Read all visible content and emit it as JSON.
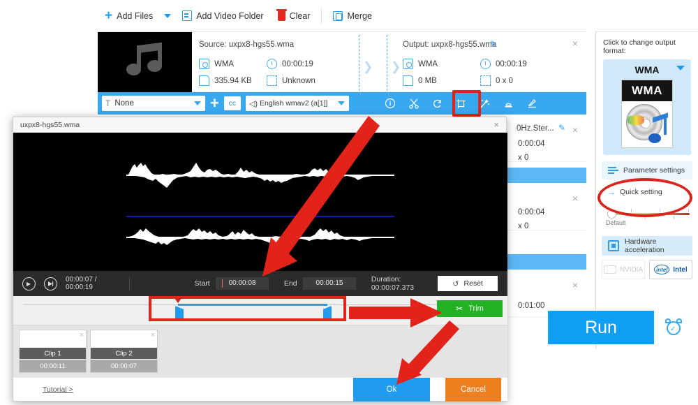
{
  "toolbar": {
    "add_files": "Add Files",
    "add_video_folder": "Add Video Folder",
    "clear": "Clear",
    "merge": "Merge"
  },
  "file_row": {
    "source_label": "Source: uxpx8-hgs55.wma",
    "output_label": "Output: uxpx8-hgs55.wma",
    "source_format": "WMA",
    "source_duration": "00:00:19",
    "source_size": "335.94 KB",
    "source_resolution": "Unknown",
    "output_format": "WMA",
    "output_duration": "00:00:19",
    "output_size": "0 MB",
    "output_resolution": "0 x 0",
    "close": "×",
    "edit_icon": "✎"
  },
  "blue_bar": {
    "subtitle_value": "None",
    "subtitle_icon": "T",
    "add": "+",
    "cc": "cc",
    "audio_track": "English wmav2 (a[1]]",
    "speaker_icon": "◁)",
    "tools": [
      {
        "name": "info-icon",
        "title": "Info"
      },
      {
        "name": "trim-icon",
        "title": "Trim"
      },
      {
        "name": "rotate-icon",
        "title": "Rotate"
      },
      {
        "name": "crop-icon",
        "title": "Crop"
      },
      {
        "name": "effect-icon",
        "title": "Effect"
      },
      {
        "name": "watermark-icon",
        "title": "Watermark"
      },
      {
        "name": "subtitle-icon",
        "title": "Subtitle"
      }
    ]
  },
  "background_rows": [
    {
      "title_fragment": "0Hz.Ster...",
      "duration": "0:00:04",
      "resolution": "x 0"
    },
    {
      "title_fragment": "",
      "duration": "0:00:04",
      "resolution": "x 0"
    },
    {
      "title_fragment": "",
      "duration": "0:01:00",
      "resolution": ""
    }
  ],
  "sidebar": {
    "hint": "Click to change output format:",
    "format_name": "WMA",
    "disc_label": "WMA",
    "parameter_settings": "Parameter settings",
    "quick_setting": "Quick setting",
    "slider_default_label": "Default",
    "hardware_acceleration": "Hardware acceleration",
    "gpu_nvidia": "NVIDIA",
    "gpu_intel": "Intel",
    "intel_badge": "intel",
    "run": "Run"
  },
  "dialog": {
    "title": "uxpx8-hgs55.wma",
    "close": "×",
    "play": "▶",
    "step": "▶",
    "current_time": "00:00:07 / 00:00:19",
    "start_label": "Start",
    "start_value": "00:00:08",
    "end_label": "End",
    "end_value": "00:00:15",
    "duration_text": "Duration: 00:00:07.373",
    "reset": "Reset",
    "reset_icon": "↺",
    "trim": "Trim",
    "trim_icon": "✂",
    "clips": [
      {
        "name": "Clip 1",
        "duration": "00:00:11",
        "close": "×"
      },
      {
        "name": "Clip 2",
        "duration": "00:00:07",
        "close": "×"
      }
    ],
    "tutorial": "Tutorial >",
    "ok": "Ok",
    "cancel": "Cancel"
  },
  "colors": {
    "accent_blue": "#1f9cf0",
    "bar_blue": "#38a8f0",
    "annotation_red": "#e2231a",
    "trim_green": "#22b223",
    "cancel_orange": "#f07f20"
  }
}
